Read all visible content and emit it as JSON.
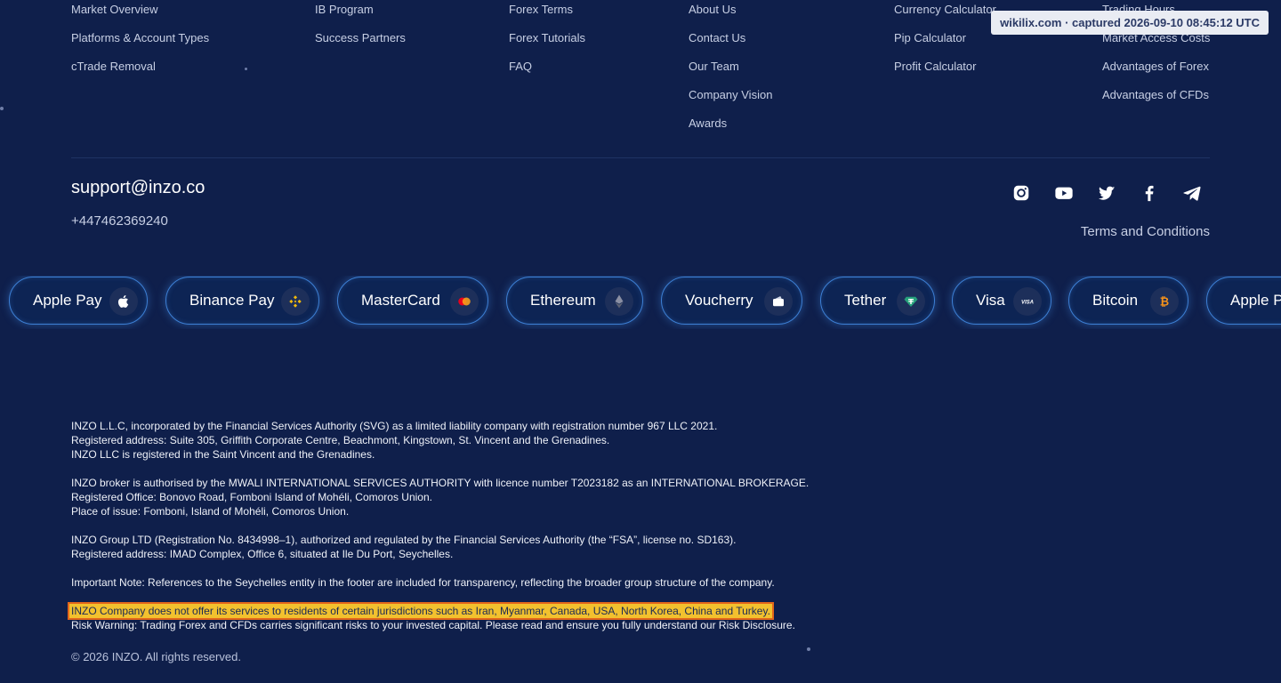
{
  "nav_columns": [
    [
      "Market Overview",
      "Platforms & Account Types",
      "cTrade Removal"
    ],
    [
      "IB Program",
      "Success Partners"
    ],
    [
      "Forex Terms",
      "Forex Tutorials",
      "FAQ"
    ],
    [
      "About Us",
      "Contact Us",
      "Our Team",
      "Company Vision",
      "Awards"
    ],
    [
      "Currency Calculator",
      "Pip Calculator",
      "Profit Calculator"
    ],
    [
      "Trading Hours",
      "Market Access Costs",
      "Advantages of Forex",
      "Advantages of CFDs"
    ]
  ],
  "contact": {
    "email": "support@inzo.co",
    "phone": "+447462369240"
  },
  "social_icons": [
    "instagram-icon",
    "youtube-icon",
    "twitter-icon",
    "facebook-icon",
    "telegram-icon"
  ],
  "terms_label": "Terms and Conditions",
  "payments": [
    {
      "label": "Apple Pay",
      "icon": "apple-icon"
    },
    {
      "label": "Binance Pay",
      "icon": "binance-icon"
    },
    {
      "label": "MasterCard",
      "icon": "mastercard-icon"
    },
    {
      "label": "Ethereum",
      "icon": "ethereum-icon"
    },
    {
      "label": "Voucherry",
      "icon": "voucher-icon"
    },
    {
      "label": "Tether",
      "icon": "tether-icon"
    },
    {
      "label": "Visa",
      "icon": "visa-icon"
    },
    {
      "label": "Bitcoin",
      "icon": "bitcoin-icon"
    },
    {
      "label": "Apple Pay",
      "icon": "apple-icon"
    }
  ],
  "legal": [
    [
      "INZO L.L.C, incorporated by the Financial Services Authority (SVG) as a limited liability company with registration number 967 LLC 2021.",
      "Registered address: Suite 305, Griffith Corporate Centre, Beachmont, Kingstown, St. Vincent and the Grenadines.",
      "INZO LLC is registered in the Saint Vincent and the Grenadines."
    ],
    [
      "INZO broker is authorised by the MWALI INTERNATIONAL SERVICES AUTHORITY with licence number T2023182 as an INTERNATIONAL BROKERAGE.",
      "Registered Office: Bonovo Road, Fomboni Island of Mohéli, Comoros Union.",
      "Place of issue: Fomboni, Island of Mohéli, Comoros Union."
    ],
    [
      "INZO Group LTD (Registration No. 8434998–1), authorized and regulated by the Financial Services Authority (the “FSA”, license no. SD163).",
      "Registered address: IMAD Complex, Office 6, situated at Ile Du Port, Seychelles."
    ],
    [
      "Important Note: References to the Seychelles entity in the footer are included for transparency, reflecting the broader group structure of the company."
    ]
  ],
  "highlight_notice": "INZO Company does not offer its services to residents of certain jurisdictions such as Iran, Myanmar, Canada, USA, North Korea, China and Turkey.",
  "risk_warning": "Risk Warning: Trading Forex and CFDs carries significant risks to your invested capital. Please read and ensure you fully understand our Risk Disclosure.",
  "copyright": "© 2026 INZO. All rights reserved.",
  "capture_stamp": "wikilix.com · captured 2026-09-10 08:45:12 UTC",
  "colors": {
    "background": "#0f1f4b",
    "pill_border": "#3d7fd4",
    "highlight": "#f2c12e",
    "highlight_outline": "#e2661b"
  }
}
